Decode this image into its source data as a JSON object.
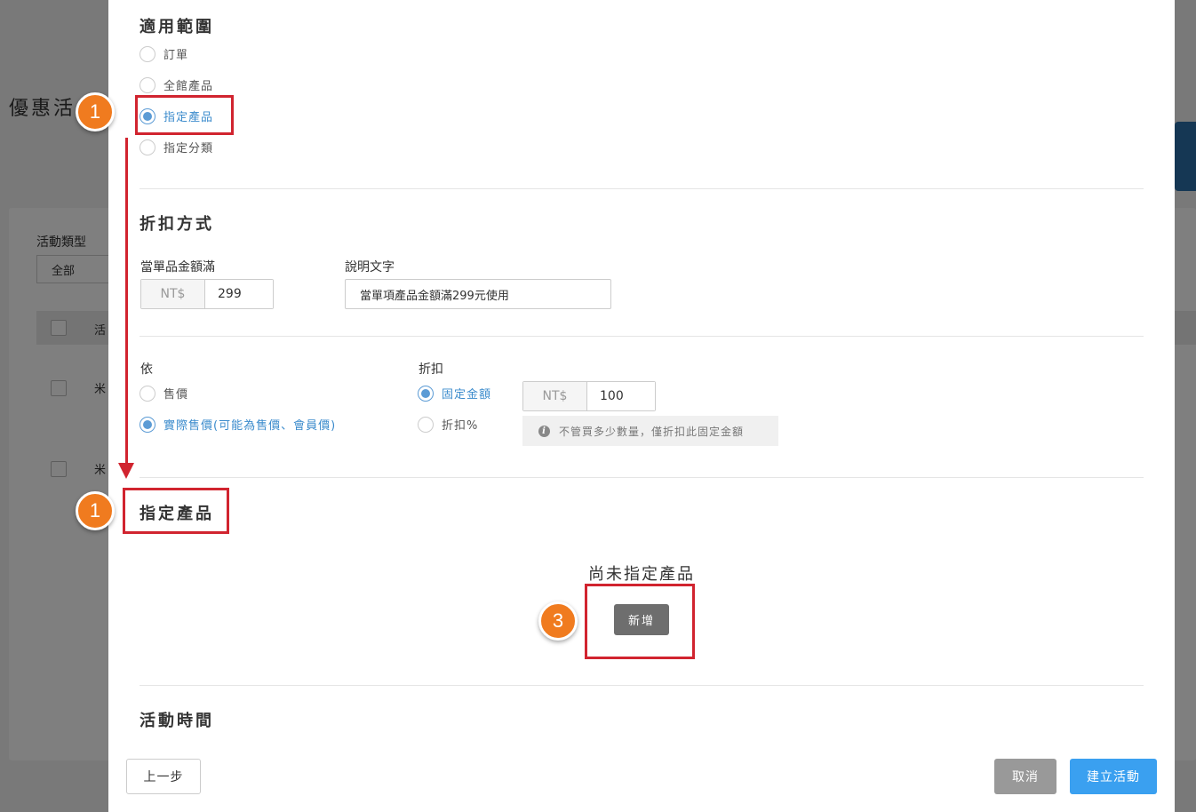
{
  "background": {
    "title": "優惠活",
    "filter_label": "活動類型",
    "filter_value": "全部",
    "header_cell": "活",
    "row1_cell": "米",
    "row2_cell": "米",
    "accent_color": "#2a6fa8"
  },
  "scope": {
    "title": "適用範圍",
    "options": [
      {
        "label": "訂單",
        "checked": false
      },
      {
        "label": "全館產品",
        "checked": false
      },
      {
        "label": "指定產品",
        "checked": true
      },
      {
        "label": "指定分類",
        "checked": false
      }
    ]
  },
  "discount_method": {
    "title": "折扣方式",
    "threshold_label": "當單品金額滿",
    "threshold_currency": "NT$",
    "threshold_value": "299",
    "desc_label": "說明文字",
    "desc_value": "當單項產品金額滿299元使用"
  },
  "basis": {
    "label": "依",
    "options": [
      {
        "label": "售價",
        "checked": false
      },
      {
        "label": "實際售價(可能為售價、會員價)",
        "checked": true
      }
    ]
  },
  "discount": {
    "label": "折扣",
    "options": [
      {
        "label": "固定金額",
        "checked": true
      },
      {
        "label": "折扣%",
        "checked": false
      }
    ],
    "currency": "NT$",
    "value": "100",
    "hint": "不管買多少數量，僅折扣此固定金額"
  },
  "products": {
    "title": "指定產品",
    "empty_text": "尚未指定產品",
    "add_label": "新增"
  },
  "activity_time": {
    "title": "活動時間"
  },
  "footer": {
    "prev_label": "上一步",
    "cancel_label": "取消",
    "create_label": "建立活動"
  },
  "annotations": {
    "badge_1a": "1",
    "badge_1b": "1",
    "badge_3": "3",
    "highlight_color": "#d1242f",
    "badge_color": "#f07b1f"
  }
}
